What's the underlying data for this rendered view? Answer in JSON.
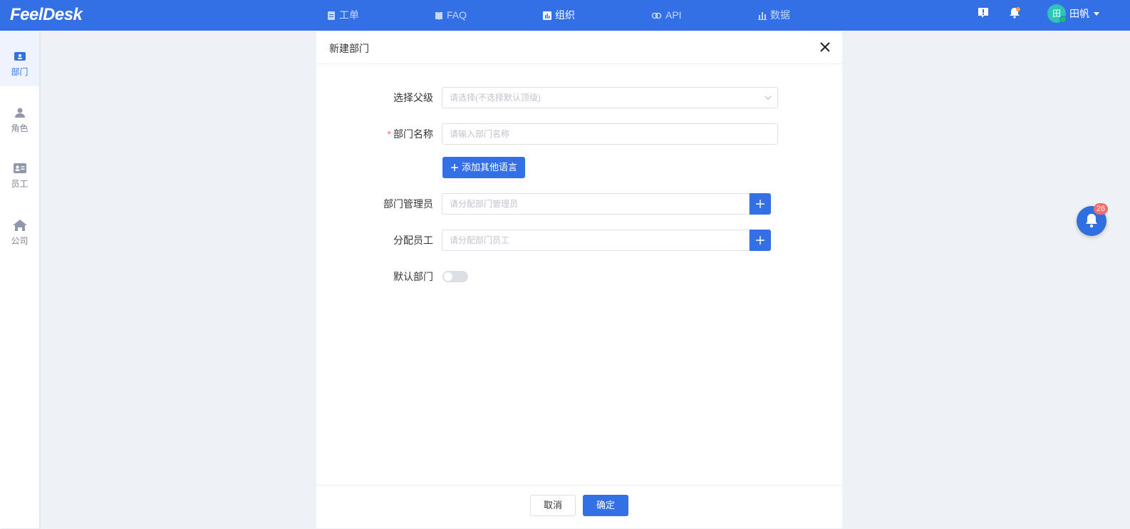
{
  "app": {
    "logo": "FeelDesk"
  },
  "nav": {
    "items": [
      {
        "label": "工单",
        "icon": "document-icon"
      },
      {
        "label": "FAQ",
        "icon": "book-icon"
      },
      {
        "label": "组织",
        "icon": "org-chart-icon",
        "active": true
      },
      {
        "label": "API",
        "icon": "api-link-icon"
      },
      {
        "label": "数据",
        "icon": "bar-chart-icon"
      }
    ]
  },
  "topbar": {
    "user_avatar_char": "田",
    "user_name": "田帆"
  },
  "sidebar": {
    "items": [
      {
        "label": "部门",
        "icon": "department-icon",
        "active": true
      },
      {
        "label": "角色",
        "icon": "person-icon"
      },
      {
        "label": "员工",
        "icon": "id-card-icon"
      },
      {
        "label": "公司",
        "icon": "home-icon"
      }
    ]
  },
  "modal": {
    "title": "新建部门",
    "fields": {
      "parent": {
        "label": "选择父级",
        "placeholder": "请选择(不选择默认顶级)"
      },
      "name": {
        "label": "部门名称",
        "required_mark": "*",
        "placeholder": "请输入部门名称"
      },
      "add_language": "添加其他语言",
      "manager": {
        "label": "部门管理员",
        "placeholder": "请分配部门管理员"
      },
      "staff": {
        "label": "分配员工",
        "placeholder": "请分配部门员工"
      },
      "default_dept": {
        "label": "默认部门",
        "enabled": false
      }
    },
    "footer": {
      "cancel": "取消",
      "confirm": "确定"
    }
  },
  "floating": {
    "badge_count": "26"
  },
  "colors": {
    "primary": "#3370e6",
    "danger": "#f56c6c",
    "page_bg": "#eef1f5"
  }
}
